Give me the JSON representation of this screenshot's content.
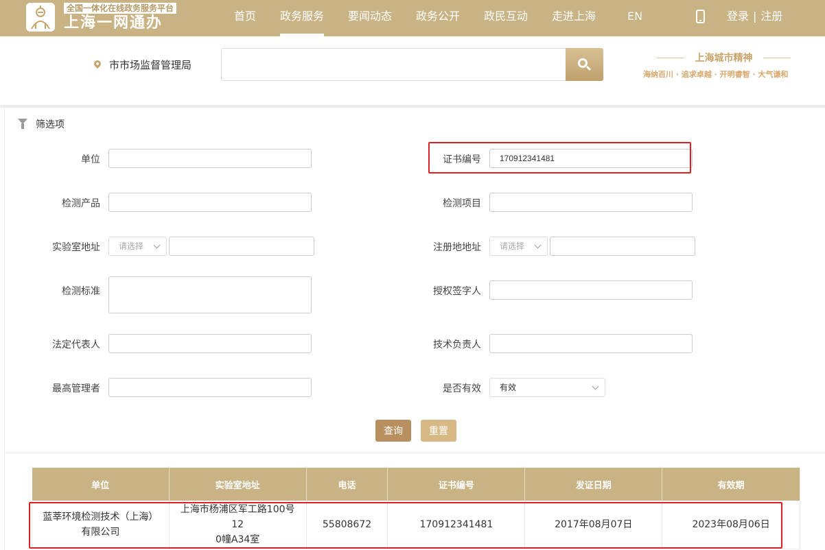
{
  "header": {
    "platform_tag": "全国一体化在线政务服务平台",
    "brand_name": "上海一网通办",
    "nav": [
      {
        "label": "首页",
        "active": false
      },
      {
        "label": "政务服务",
        "active": true
      },
      {
        "label": "要闻动态",
        "active": false
      },
      {
        "label": "政务公开",
        "active": false
      },
      {
        "label": "政民互动",
        "active": false
      },
      {
        "label": "走进上海",
        "active": false
      },
      {
        "label": "EN",
        "active": false
      }
    ],
    "login": "登录",
    "separator": "|",
    "register": "注册",
    "colors": {
      "bar": "#c9b384",
      "accent": "#c9a56d"
    }
  },
  "subheader": {
    "location": "市市场监督管理局",
    "search_value": "",
    "spirit_title": "上海城市精神",
    "spirit_motto": "海纳百川 · 追求卓越 · 开明睿智 · 大气谦和"
  },
  "filter": {
    "title": "筛选项",
    "labels": {
      "unit": "单位",
      "cert_no": "证书编号",
      "product": "检测产品",
      "item": "检测项目",
      "lab_addr": "实验室地址",
      "reg_addr": "注册地地址",
      "standard": "检测标准",
      "signer": "授权签字人",
      "legal_rep": "法定代表人",
      "tech_lead": "技术负责人",
      "top_manager": "最高管理者",
      "valid": "是否有效"
    },
    "values": {
      "cert_no": "170912341481",
      "valid": "有效"
    },
    "select_placeholder": "请选择",
    "query_btn": "查询",
    "reset_btn": "重置"
  },
  "results": {
    "columns": [
      "单位",
      "实验室地址",
      "电话",
      "证书编号",
      "发证日期",
      "有效期"
    ],
    "rows": [
      {
        "unit_line1": "蓝莘环境检测技术（上海）",
        "unit_line2": "有限公司",
        "lab_addr_line1": "上海市杨浦区军工路100号12",
        "lab_addr_line2": "0幢A34室",
        "phone": "55808672",
        "cert_no": "170912341481",
        "issue_date": "2017年08月07日",
        "expiry": "2023年08月06日"
      }
    ]
  }
}
